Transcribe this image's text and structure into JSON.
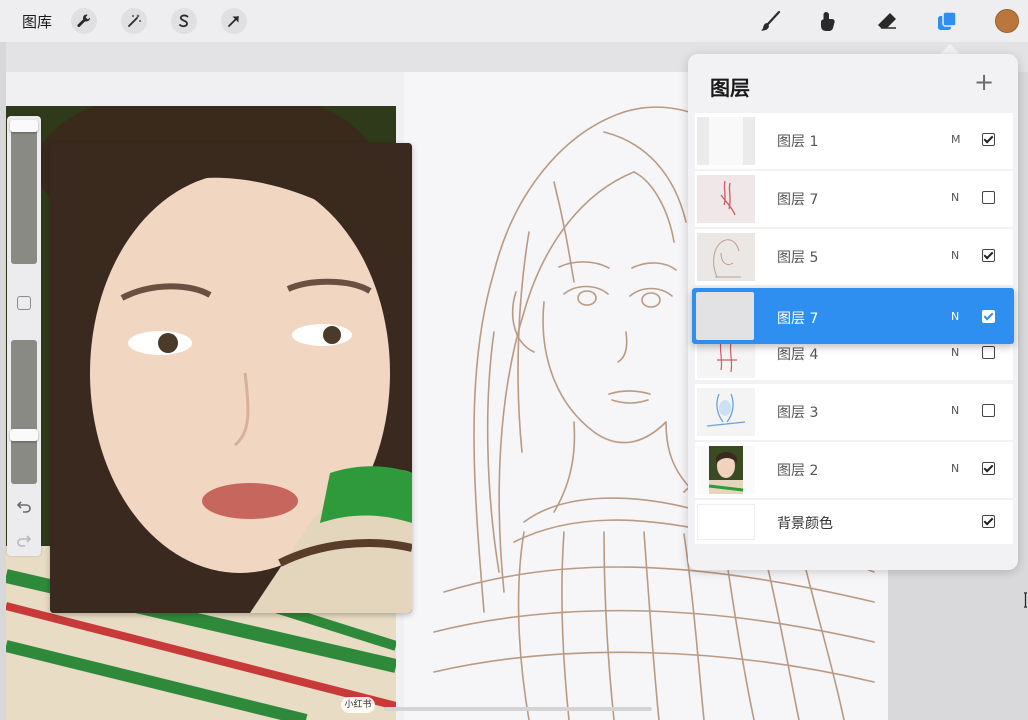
{
  "toolbar": {
    "gallery_label": "图库",
    "left_tools": [
      "wrench-icon",
      "magic-wand-icon",
      "selection-icon",
      "transform-arrow-icon"
    ],
    "right_tools": [
      "brush-icon",
      "smudge-icon",
      "eraser-icon",
      "layers-icon"
    ],
    "active_color": "#b9773e",
    "accent_color": "#2f8ff0"
  },
  "layers_panel": {
    "title": "图层",
    "add_symbol": "+",
    "layers": [
      {
        "name": "图层 1",
        "mode": "M",
        "visible": true
      },
      {
        "name": "图层 7",
        "mode": "N",
        "visible": false
      },
      {
        "name": "图层 5",
        "mode": "N",
        "visible": true
      },
      {
        "name": "图层 4",
        "mode": "N",
        "visible": false
      },
      {
        "name": "图层 3",
        "mode": "N",
        "visible": false
      },
      {
        "name": "图层 2",
        "mode": "N",
        "visible": true
      },
      {
        "name": "背景颜色",
        "mode": "",
        "visible": true
      }
    ],
    "dragging_layer": {
      "name": "图层 7",
      "mode": "N",
      "visible": true
    }
  },
  "sidebar": {
    "undo_icon": "undo-icon",
    "redo_icon": "redo-icon"
  },
  "watermark": "小红书"
}
